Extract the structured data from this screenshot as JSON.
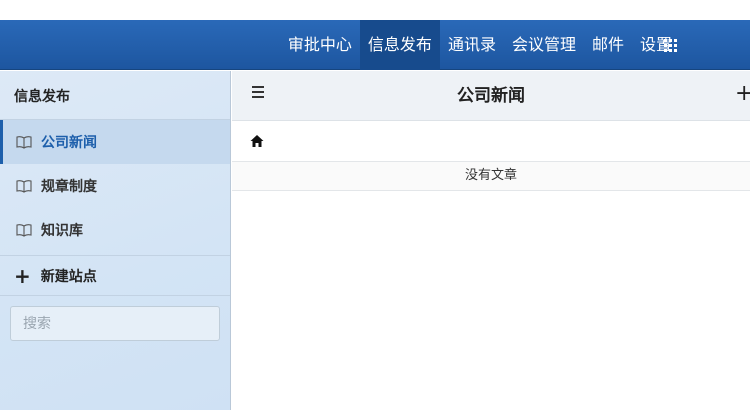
{
  "topnav": {
    "items": [
      {
        "label": "审批中心",
        "active": false
      },
      {
        "label": "信息发布",
        "active": true
      },
      {
        "label": "通讯录",
        "active": false
      },
      {
        "label": "会议管理",
        "active": false
      },
      {
        "label": "邮件",
        "active": false
      },
      {
        "label": "设置",
        "active": false
      }
    ],
    "apps_icon": "grid-apps-icon"
  },
  "sidebar": {
    "title": "信息发布",
    "items": [
      {
        "label": "公司新闻",
        "icon": "book-icon",
        "active": true
      },
      {
        "label": "规章制度",
        "icon": "book-icon",
        "active": false
      },
      {
        "label": "知识库",
        "icon": "book-icon",
        "active": false
      }
    ],
    "new_site_label": "新建站点",
    "search_placeholder": "搜索"
  },
  "main": {
    "title": "公司新闻",
    "empty_text": "没有文章"
  },
  "colors": {
    "topbar": "#1d56a0",
    "active_nav": "#174b8d",
    "sidebar_bg": "#d3e4f5",
    "accent": "#1d5fab"
  }
}
